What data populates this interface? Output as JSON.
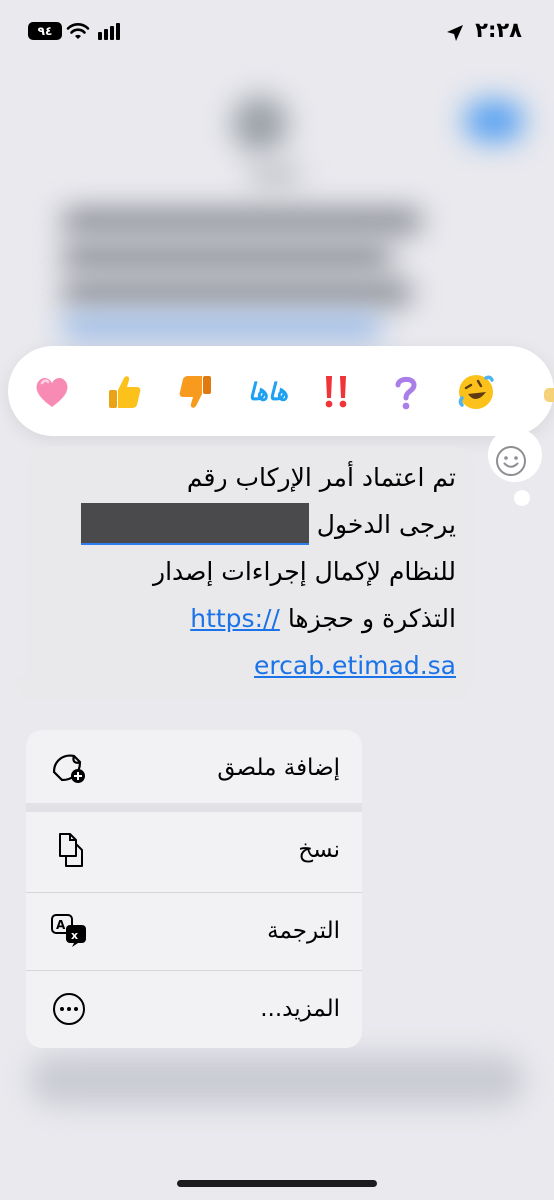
{
  "status_bar": {
    "time": "٢:٢٨",
    "battery": "٩٤"
  },
  "reactions": [
    {
      "name": "heart",
      "glyph": "❤"
    },
    {
      "name": "thumbs-up",
      "glyph": "👍"
    },
    {
      "name": "thumbs-down",
      "glyph": "👎"
    },
    {
      "name": "haha",
      "glyph": "هاها"
    },
    {
      "name": "exclamation",
      "glyph": "‼"
    },
    {
      "name": "question",
      "glyph": "?"
    },
    {
      "name": "laughing",
      "glyph": "🤣"
    }
  ],
  "message": {
    "line1": "تم اعتماد أمر الإركاب رقم",
    "line2": "يرجى الدخول",
    "line3": "للنظام لإكمال إجراءات إصدار",
    "line4_text": "التذكرة و حجزها",
    "line4_link": "https://",
    "line5_link": "ercab.etimad.sa"
  },
  "menu": {
    "add_sticker": "إضافة ملصق",
    "copy": "نسخ",
    "translate": "الترجمة",
    "more": "المزيد..."
  },
  "colors": {
    "link": "#1a73e8",
    "bubble": "#e9e9eb",
    "redaction": "#4a4a4c"
  }
}
